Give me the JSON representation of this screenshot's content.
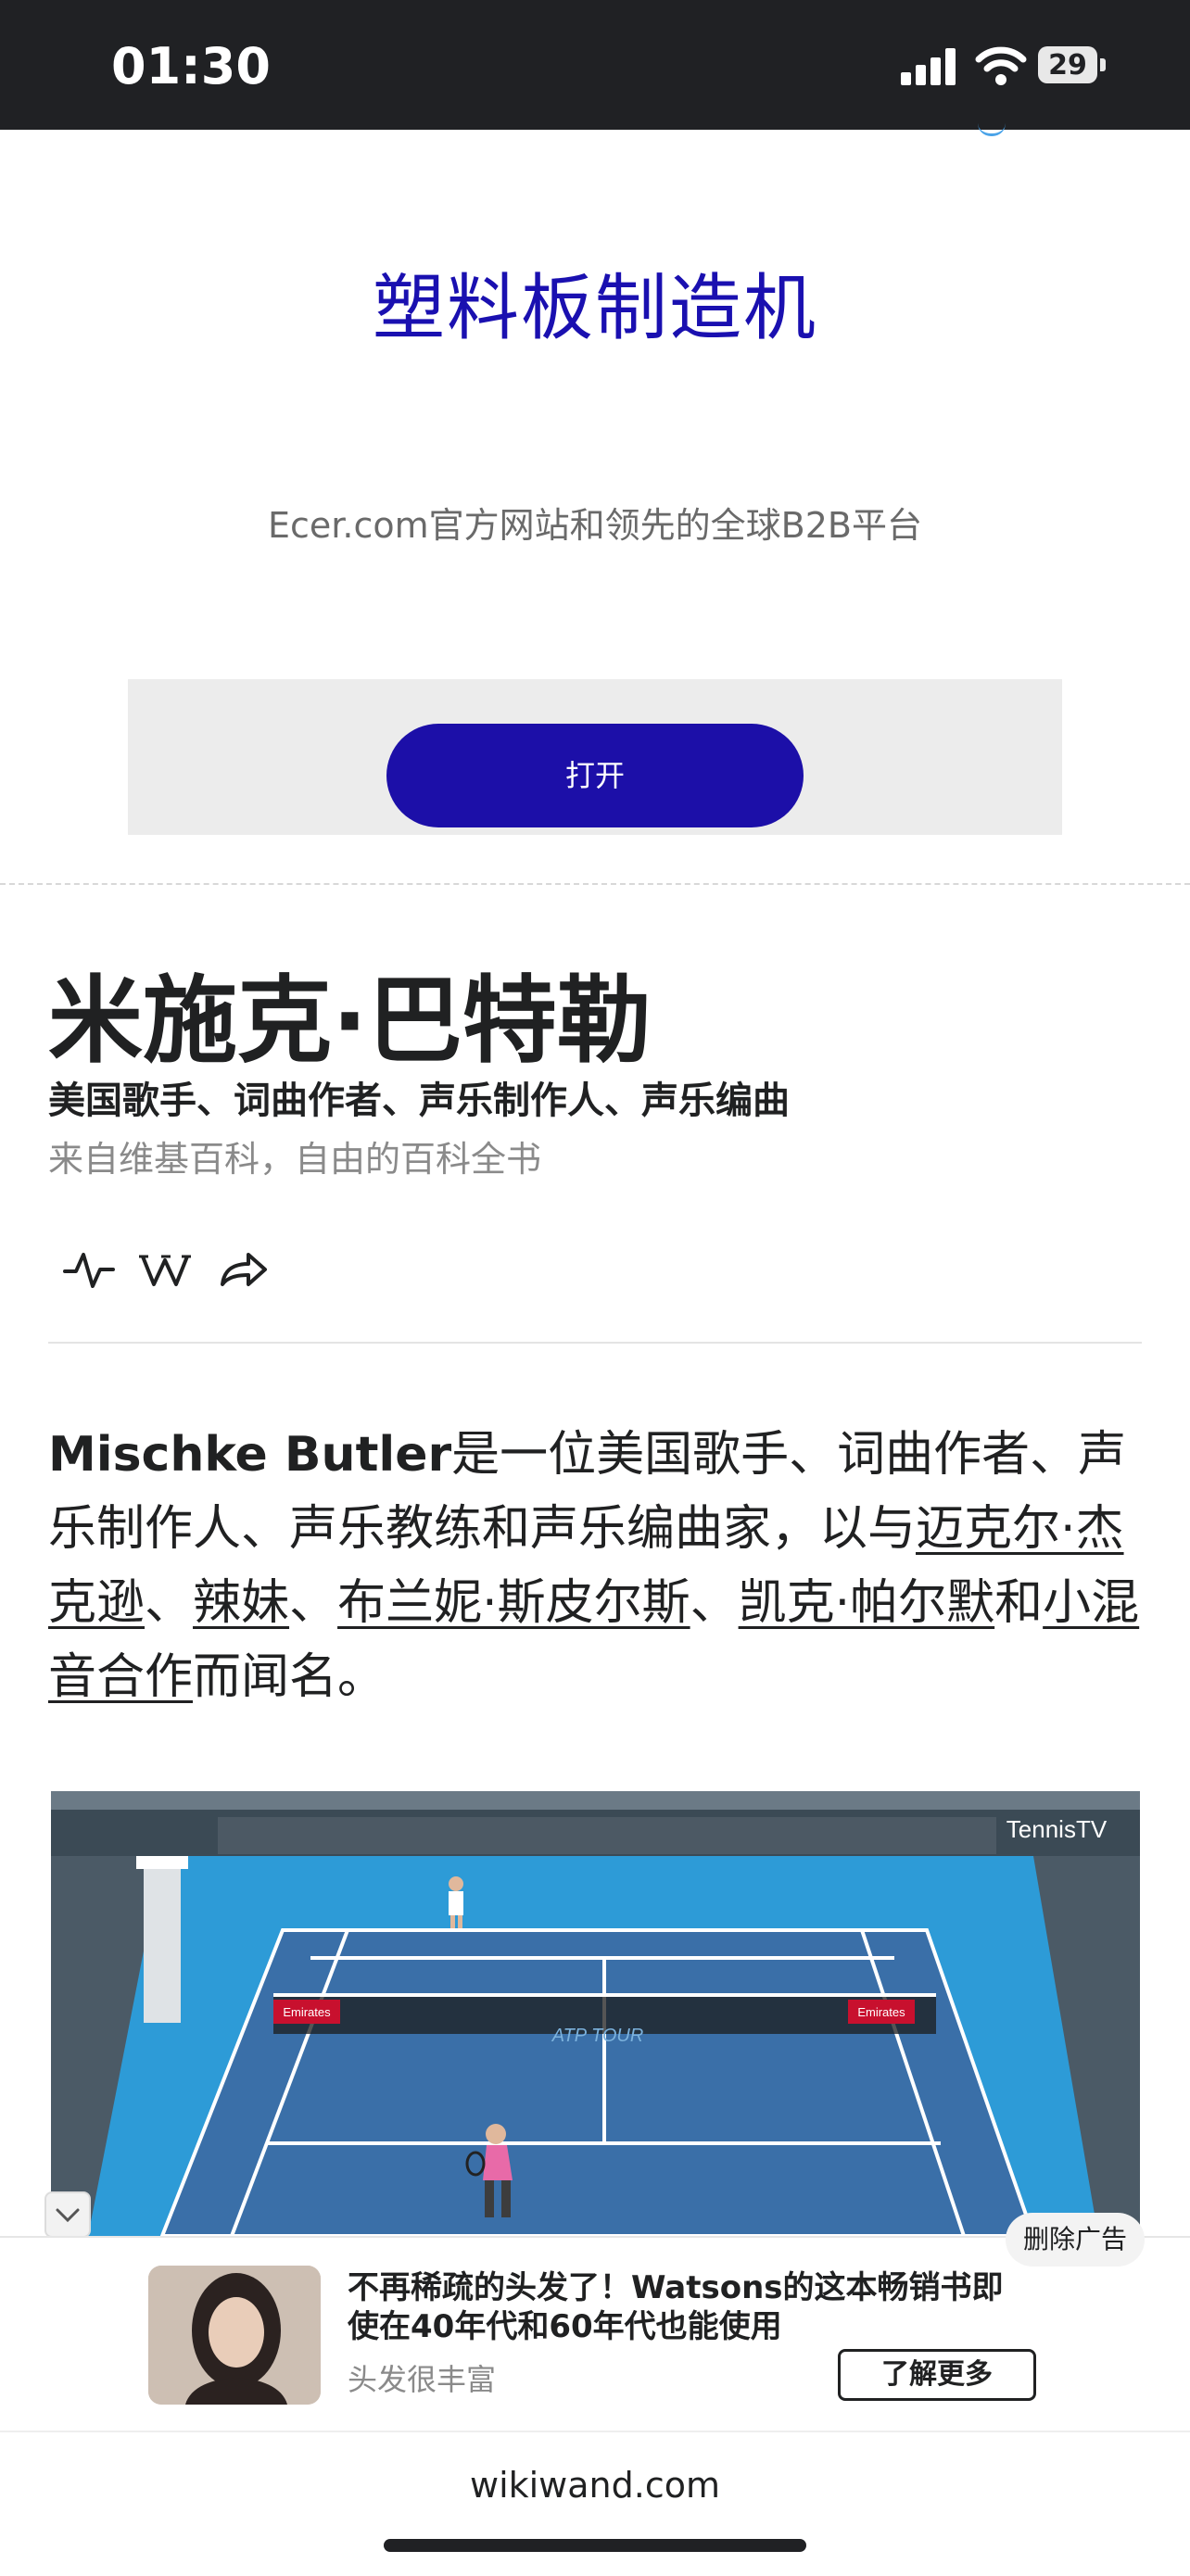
{
  "status_bar": {
    "time": "01:30",
    "battery": "29"
  },
  "top_ad": {
    "title": "塑料板制造机",
    "subtitle": "Ecer.com官方网站和领先的全球B2B平台",
    "button_label": "打开"
  },
  "article": {
    "title": "米施克·巴特勒",
    "description": "美国歌手、词曲作者、声乐制作人、声乐编曲",
    "source": "来自维基百科，自由的百科全书",
    "toolbar": {
      "icons": [
        "activity-icon",
        "wikipedia-icon",
        "share-icon"
      ]
    },
    "paragraph": {
      "bold_name": "Mischke Butler",
      "text_1": "是一位美国歌手、词曲作者、声乐制作人、声乐教练和声乐编曲家，以与",
      "link_1": "迈克尔·杰克逊",
      "sep_1": "、",
      "link_2": "辣妹",
      "sep_2": "、",
      "link_3": "布兰妮·斯皮尔斯",
      "sep_3": "、",
      "link_4": "凯克·帕尔默",
      "sep_4": "和",
      "link_5": "小混音合作",
      "text_end": "而闻名。"
    }
  },
  "video": {
    "banner_left": "Emirates",
    "banner_right": "Emirates",
    "court_logo": "ATP TOUR",
    "corner_logo": "TennisTV"
  },
  "bottom_ad": {
    "remove_label": "删除广告",
    "headline": "不再稀疏的头发了！Watsons的这本畅销书即使在40年代和60年代也能使用",
    "brand": "头发很丰富",
    "cta": "了解更多"
  },
  "browser": {
    "url": "wikiwand.com"
  },
  "colors": {
    "ad_blue": "#1a10b0",
    "court_blue": "#2c9ad6",
    "text": "#202122"
  }
}
